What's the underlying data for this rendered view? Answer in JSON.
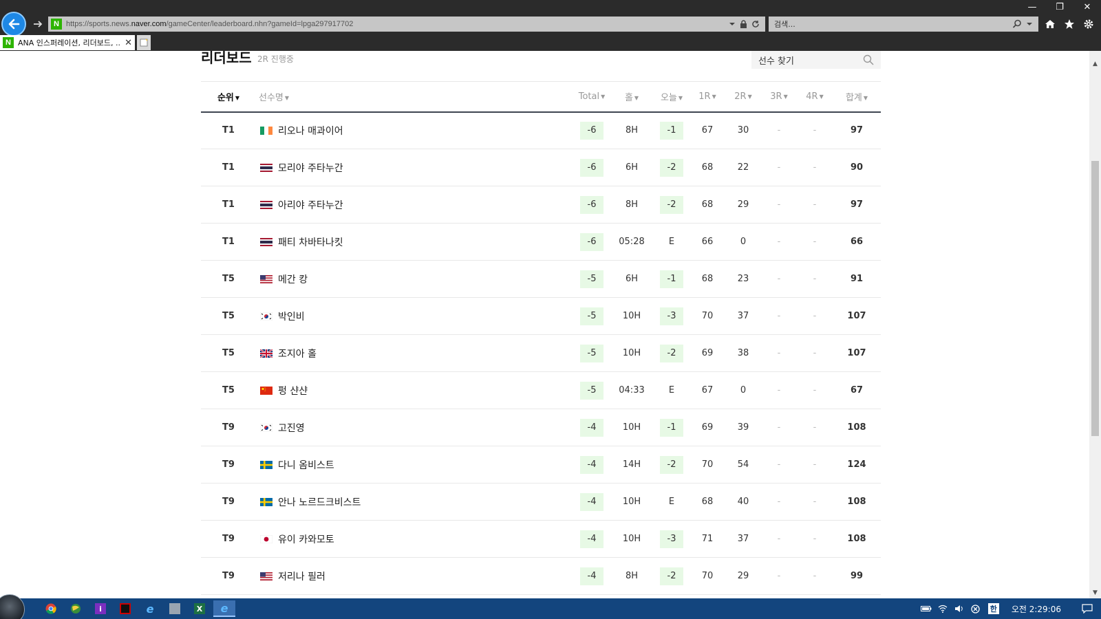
{
  "browser": {
    "url_prefix": "https://sports.news.",
    "url_host": "naver.com",
    "url_rest": "/gameCenter/leaderboard.nhn?gameId=lpga297917702",
    "search_placeholder": "검색...",
    "tab_title": "ANA 인스퍼레이션, 리더보드, ...",
    "tab_favicon": "N"
  },
  "leaderboard": {
    "title": "리더보드",
    "status": "2R 진행중",
    "search_label": "선수 찾기",
    "columns": {
      "rank": "순위",
      "name": "선수명",
      "total": "Total",
      "hole": "홀",
      "today": "오늘",
      "r1": "1R",
      "r2": "2R",
      "r3": "3R",
      "r4": "4R",
      "sum": "합계"
    },
    "rows": [
      {
        "rank": "T1",
        "flag": "ireland",
        "name": "리오나 매과이어",
        "total": "-6",
        "hole": "8H",
        "today": "-1",
        "r1": "67",
        "r2": "30",
        "r3": "-",
        "r4": "-",
        "sum": "97"
      },
      {
        "rank": "T1",
        "flag": "thailand",
        "name": "모리야 주타누간",
        "total": "-6",
        "hole": "6H",
        "today": "-2",
        "r1": "68",
        "r2": "22",
        "r3": "-",
        "r4": "-",
        "sum": "90"
      },
      {
        "rank": "T1",
        "flag": "thailand",
        "name": "아리야 주타누간",
        "total": "-6",
        "hole": "8H",
        "today": "-2",
        "r1": "68",
        "r2": "29",
        "r3": "-",
        "r4": "-",
        "sum": "97"
      },
      {
        "rank": "T1",
        "flag": "thailand",
        "name": "패티 차바타나킷",
        "total": "-6",
        "hole": "05:28",
        "today": "E",
        "r1": "66",
        "r2": "0",
        "r3": "-",
        "r4": "-",
        "sum": "66"
      },
      {
        "rank": "T5",
        "flag": "usa",
        "name": "메간 캉",
        "total": "-5",
        "hole": "6H",
        "today": "-1",
        "r1": "68",
        "r2": "23",
        "r3": "-",
        "r4": "-",
        "sum": "91"
      },
      {
        "rank": "T5",
        "flag": "korea",
        "name": "박인비",
        "total": "-5",
        "hole": "10H",
        "today": "-3",
        "r1": "70",
        "r2": "37",
        "r3": "-",
        "r4": "-",
        "sum": "107"
      },
      {
        "rank": "T5",
        "flag": "uk",
        "name": "조지아 홀",
        "total": "-5",
        "hole": "10H",
        "today": "-2",
        "r1": "69",
        "r2": "38",
        "r3": "-",
        "r4": "-",
        "sum": "107"
      },
      {
        "rank": "T5",
        "flag": "china",
        "name": "펑 샨샨",
        "total": "-5",
        "hole": "04:33",
        "today": "E",
        "r1": "67",
        "r2": "0",
        "r3": "-",
        "r4": "-",
        "sum": "67"
      },
      {
        "rank": "T9",
        "flag": "korea",
        "name": "고진영",
        "total": "-4",
        "hole": "10H",
        "today": "-1",
        "r1": "69",
        "r2": "39",
        "r3": "-",
        "r4": "-",
        "sum": "108"
      },
      {
        "rank": "T9",
        "flag": "sweden",
        "name": "다니 옴비스트",
        "total": "-4",
        "hole": "14H",
        "today": "-2",
        "r1": "70",
        "r2": "54",
        "r3": "-",
        "r4": "-",
        "sum": "124"
      },
      {
        "rank": "T9",
        "flag": "sweden",
        "name": "안나 노르드크비스트",
        "total": "-4",
        "hole": "10H",
        "today": "E",
        "r1": "68",
        "r2": "40",
        "r3": "-",
        "r4": "-",
        "sum": "108"
      },
      {
        "rank": "T9",
        "flag": "japan",
        "name": "유이 카와모토",
        "total": "-4",
        "hole": "10H",
        "today": "-3",
        "r1": "71",
        "r2": "37",
        "r3": "-",
        "r4": "-",
        "sum": "108"
      },
      {
        "rank": "T9",
        "flag": "usa",
        "name": "저리나 필러",
        "total": "-4",
        "hole": "8H",
        "today": "-2",
        "r1": "70",
        "r2": "29",
        "r3": "-",
        "r4": "-",
        "sum": "99"
      }
    ]
  },
  "taskbar": {
    "apps": [
      "chrome-icon",
      "globe-icon",
      "info-icon",
      "red-app-icon",
      "ie-icon",
      "file-icon",
      "excel-icon",
      "ie-active-icon"
    ],
    "ime": "한",
    "clock": "오전 2:29:06"
  },
  "colors": {
    "under_par_bg": "#e7f9e5",
    "header_rule": "#3d4450",
    "naver_green": "#2db400",
    "taskbar": "#13457e"
  }
}
